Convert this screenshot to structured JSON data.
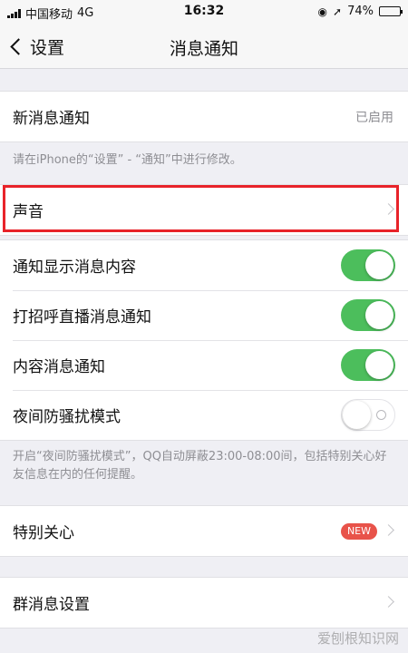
{
  "status_bar": {
    "carrier": "中国移动",
    "network": "4G",
    "time": "16:32",
    "battery": "74%",
    "battery_level": 0.74
  },
  "nav": {
    "back_label": "设置",
    "title": "消息通知"
  },
  "new_message": {
    "label": "新消息通知",
    "value": "已启用"
  },
  "hint_system": "请在iPhone的“设置” - “通知”中进行修改。",
  "sound": {
    "label": "声音"
  },
  "toggles": [
    {
      "label": "通知显示消息内容",
      "on": true
    },
    {
      "label": "打招呼直播消息通知",
      "on": true
    },
    {
      "label": "内容消息通知",
      "on": true
    },
    {
      "label": "夜间防骚扰模式",
      "on": false
    }
  ],
  "hint_night": "开启“夜间防骚扰模式”，QQ自动屏蔽23:00-08:00间，包括特别关心好友信息在内的任何提醒。",
  "special_care": {
    "label": "特别关心",
    "badge": "NEW"
  },
  "group_settings": {
    "label": "群消息设置"
  },
  "watermark": "爱刨根知识网",
  "colors": {
    "toggle_on": "#4cbe5c",
    "highlight": "#e8232a",
    "badge": "#e8534a"
  }
}
